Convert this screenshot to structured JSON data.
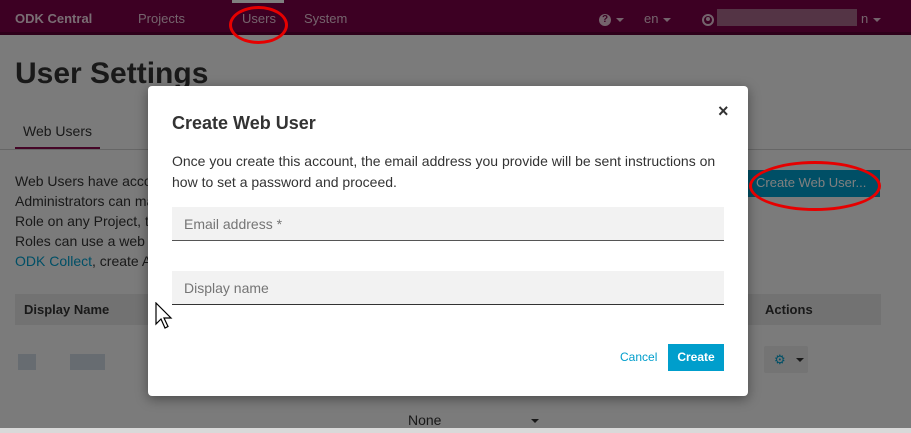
{
  "navbar": {
    "brand": "ODK Central",
    "projects": "Projects",
    "users": "Users",
    "system": "System",
    "help_icon_glyph": "?",
    "language": "en",
    "user_suffix": "n"
  },
  "page": {
    "title": "User Settings",
    "tab": "Web Users",
    "intro_lines": [
      "Web Users have acco",
      "Administrators can ma",
      "Role on any Project, t",
      "Roles can use a web",
      "ODK Collect, create A"
    ],
    "intro_link": "ODK Collect",
    "create_user_button": "Create Web User...",
    "table": {
      "col_display_name": "Display Name",
      "col_actions": "Actions"
    },
    "select_value": "None"
  },
  "modal": {
    "title": "Create Web User",
    "close_glyph": "×",
    "description": "Once you create this account, the email address you provide will be sent instructions on how to set a password and proceed.",
    "email_placeholder": "Email address *",
    "display_name_placeholder": "Display name",
    "cancel_label": "Cancel",
    "create_label": "Create"
  },
  "colors": {
    "navbar": "#7a0046",
    "accent": "#009ecc",
    "annotation": "#e60000"
  }
}
